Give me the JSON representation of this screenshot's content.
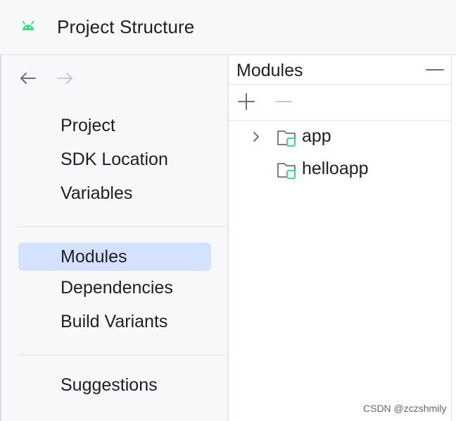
{
  "window": {
    "title": "Project Structure",
    "title_icon": "android-icon",
    "accent_color": "#3ddc84"
  },
  "sidebar": {
    "nav": {
      "back_icon": "arrow-left-icon",
      "forward_icon": "arrow-right-icon"
    },
    "groups": [
      {
        "items": [
          {
            "label": "Project",
            "selected": false
          },
          {
            "label": "SDK Location",
            "selected": false
          },
          {
            "label": "Variables",
            "selected": false
          }
        ]
      },
      {
        "items": [
          {
            "label": "Modules",
            "selected": true
          },
          {
            "label": "Dependencies",
            "selected": false
          },
          {
            "label": "Build Variants",
            "selected": false
          }
        ]
      },
      {
        "items": [
          {
            "label": "Suggestions",
            "selected": false
          }
        ]
      }
    ],
    "selected_color": "#d4e2ff"
  },
  "main": {
    "header_title": "Modules",
    "toolbar": {
      "add_icon": "plus-icon",
      "remove_icon": "minus-icon"
    },
    "tree": [
      {
        "label": "app",
        "expandable": true,
        "icon": "module-folder-icon"
      },
      {
        "label": "helloapp",
        "expandable": false,
        "icon": "module-folder-icon"
      }
    ]
  },
  "watermark": {
    "text": "CSDN @zczshmily"
  }
}
